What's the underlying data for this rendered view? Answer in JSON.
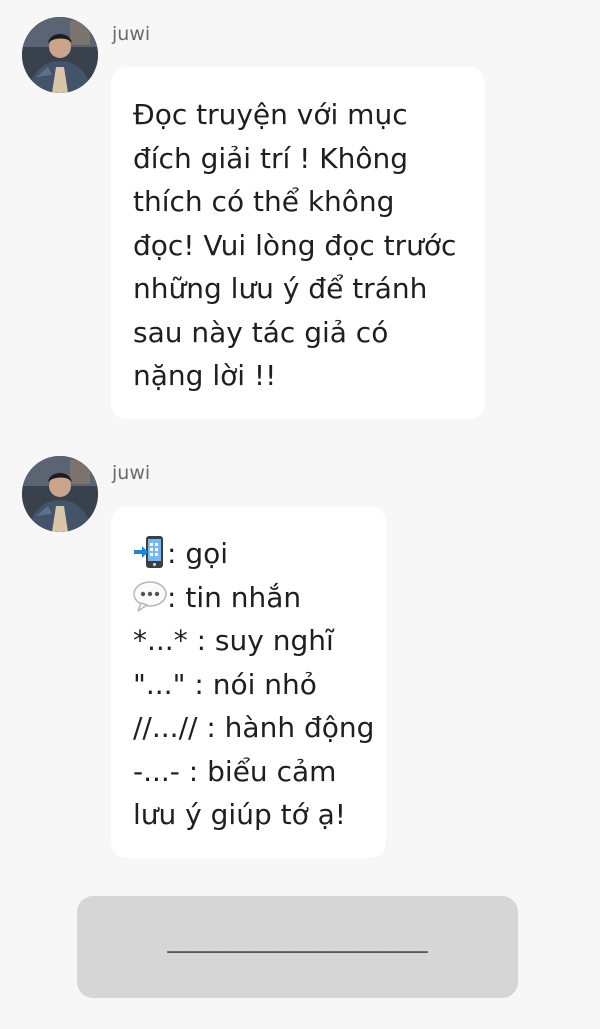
{
  "messages": [
    {
      "sender": "juwi",
      "lines": [
        "Đọc truyện với mục",
        "đích giải trí ! Không",
        "thích có thể không",
        "đọc! Vui lòng đọc trước",
        "những lưu ý để tránh",
        "sau này tác giả có",
        "nặng lời !!"
      ]
    },
    {
      "sender": "juwi",
      "legend": [
        {
          "icon": "mobile-phone-arrow-icon",
          "text": ": gọi"
        },
        {
          "icon": "speech-bubble-icon",
          "text": ": tin nhắn"
        },
        {
          "text": "*...* : suy nghĩ"
        },
        {
          "text": "\"...\" : nói nhỏ"
        },
        {
          "text": "//...// : hành động"
        },
        {
          "text": "-...- : biểu cảm"
        },
        {
          "text": "lưu ý giúp tớ ạ!"
        }
      ]
    }
  ],
  "divider": {
    "text": "____________________"
  },
  "colors": {
    "background": "#f7f7f7",
    "bubble": "#ffffff",
    "divider_card": "#d6d6d6",
    "sender": "#6a6a6a"
  }
}
